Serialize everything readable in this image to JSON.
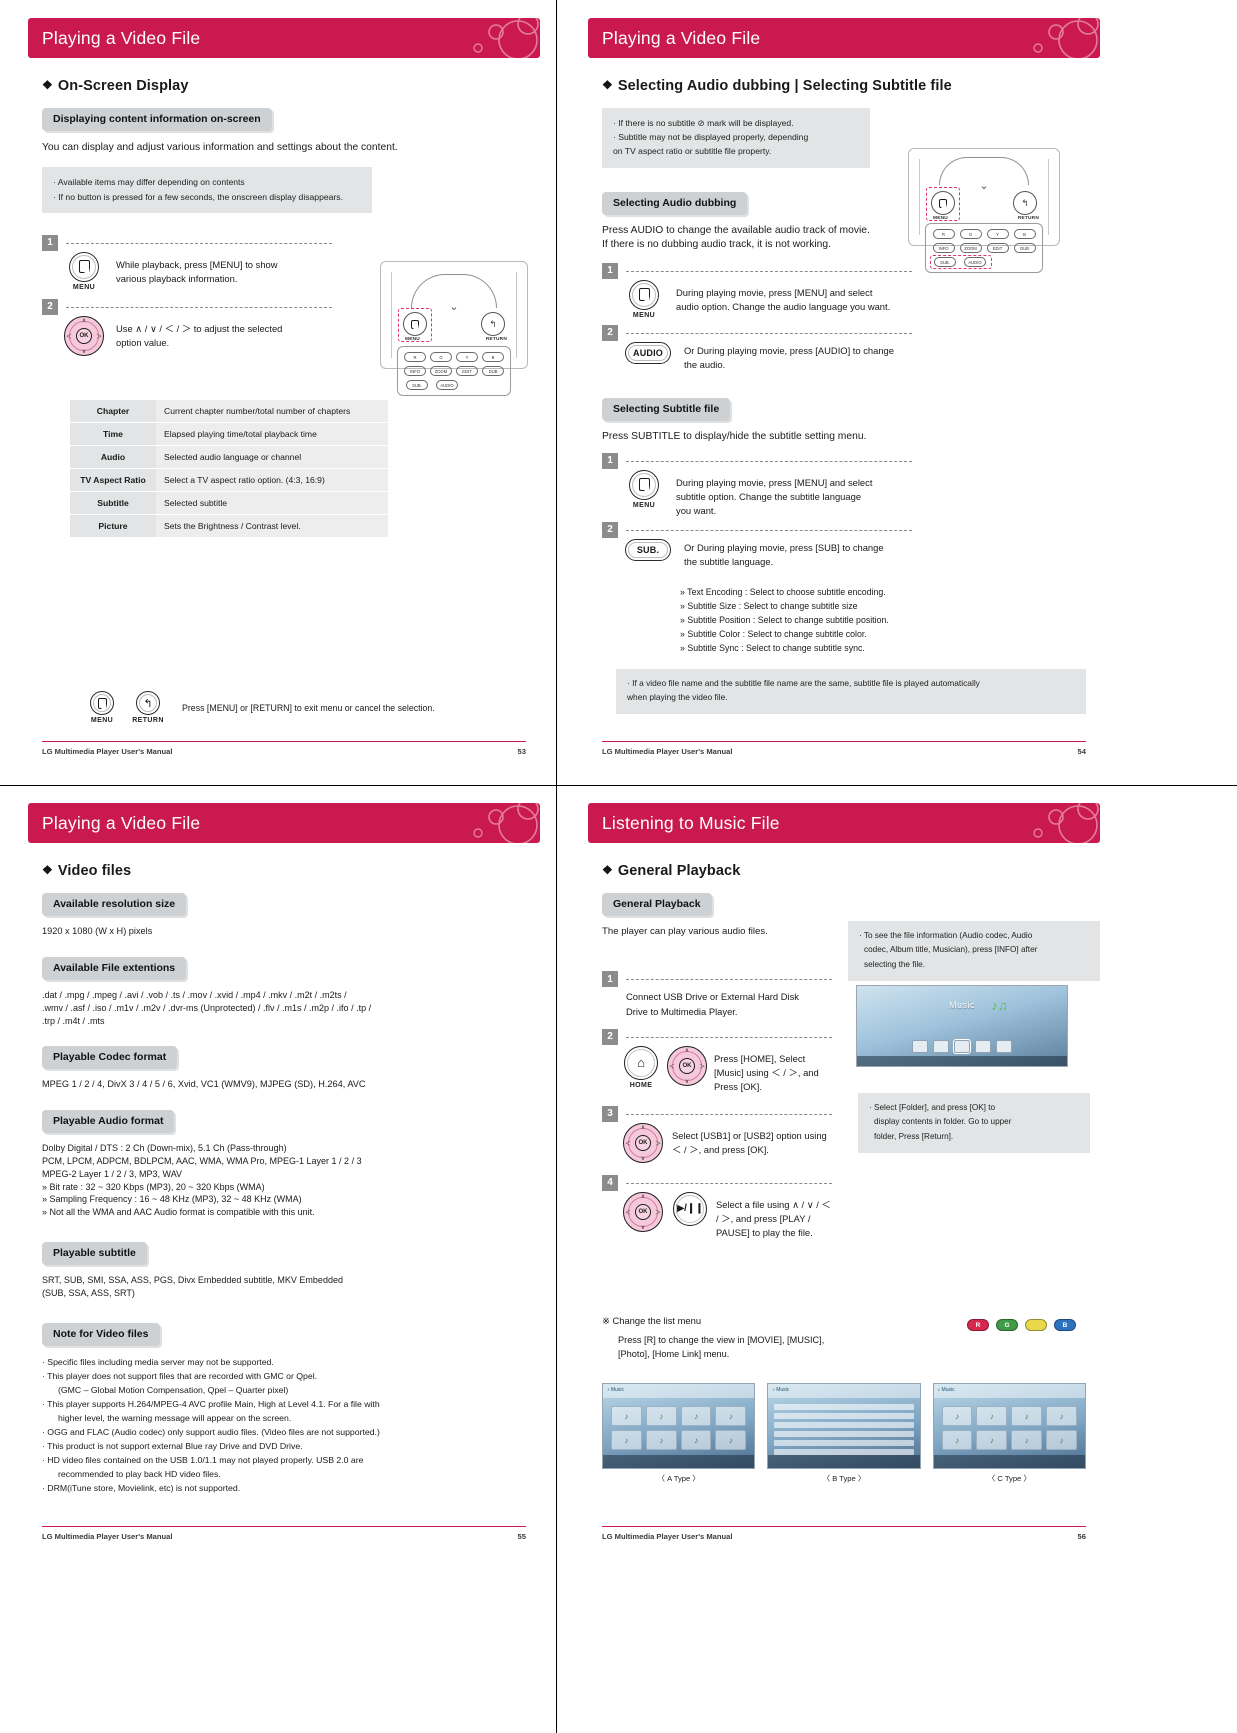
{
  "brand_color": "#c9194e",
  "pages": [
    {
      "id": "page-53",
      "banner_title": "Playing a Video File",
      "section_title": "On-Screen Display",
      "pill_1": "Displaying content information on-screen",
      "intro": "You can display and adjust various information and settings about the content.",
      "note_items": [
        "· Available items may differ depending on contents",
        "· If no button is pressed for a few seconds, the onscreen display disappears."
      ],
      "steps": [
        {
          "num": "1",
          "key_label": "MENU",
          "key_icon": "menu-key-icon",
          "text": "While playback, press [MENU]  to show various playback information."
        },
        {
          "num": "2",
          "key_label": "",
          "key_icon": "dpad-wheel-icon",
          "text": "Use ∧ / ∨ / ＜ / ＞ to adjust the selected option value."
        }
      ],
      "table": {
        "rows": [
          {
            "key": "Chapter",
            "value": "Current chapter number/total number of chapters"
          },
          {
            "key": "Time",
            "value": "Elapsed playing time/total playback time"
          },
          {
            "key": "Audio",
            "value": "Selected audio language or channel"
          },
          {
            "key": "TV Aspect Ratio",
            "value": "Select a TV aspect ratio option. (4:3, 16:9)"
          },
          {
            "key": "Subtitle",
            "value": "Selected subtitle"
          },
          {
            "key": "Picture",
            "value": "Sets the Brightness / Contrast level."
          }
        ]
      },
      "exit_hint": "Press [MENU] or [RETURN] to exit menu or cancel the selection.",
      "exit_keys": [
        "MENU",
        "RETURN"
      ],
      "footer_left": "LG Multimedia Player User's Manual",
      "footer_right": "53"
    },
    {
      "id": "page-54",
      "banner_title": "Playing a Video File",
      "section_title": "Selecting Audio dubbing | Selecting Subtitle file",
      "note_items": [
        "· If there is no subtitle ⊘ mark will be displayed.",
        "· Subtitle may not be displayed properly, depending",
        "  on TV aspect ratio or subtitle file property."
      ],
      "pill_audio": "Selecting Audio dubbing",
      "audio_intro_1": "Press AUDIO to change the available audio track of movie.",
      "audio_intro_2": "If there is no dubbing audio track, it is not working.",
      "audio_steps": [
        {
          "num": "1",
          "key_label": "MENU",
          "key_icon": "menu-key-icon",
          "text": "During playing movie, press [MENU] and select audio option. Change the audio language you want."
        },
        {
          "num": "2",
          "key_label": "AUDIO",
          "key_icon": "audio-key-icon",
          "text": "Or During playing movie, press [AUDIO] to change the audio."
        }
      ],
      "pill_subtitle": "Selecting Subtitle file",
      "subtitle_intro": "Press SUBTITLE to display/hide the subtitle setting menu.",
      "subtitle_steps": [
        {
          "num": "1",
          "key_label": "MENU",
          "key_icon": "menu-key-icon",
          "text": "During playing movie, press [MENU] and select subtitle option. Change the subtitle language you want."
        },
        {
          "num": "2",
          "key_label": "SUB.",
          "key_icon": "sub-key-icon",
          "text": "Or During playing movie, press [SUB] to change the subtitle language."
        }
      ],
      "subtitle_options": [
        "» Text Encoding : Select to choose subtitle encoding.",
        "» Subtitle Size : Select to change subtitle size",
        "» Subtitle Position : Select to change subtitle position.",
        "» Subtitle Color : Select to change subtitle color.",
        "» Subtitle Sync : Select to change subtitle sync."
      ],
      "bottom_note": [
        "· If a video file name and the subtitle file name are the same, subtitle file is played automatically",
        "  when playing the video file."
      ],
      "footer_left": "LG Multimedia Player User's Manual",
      "footer_right": "54"
    },
    {
      "id": "page-55",
      "banner_title": "Playing a Video File",
      "section_title": "Video files",
      "blocks": [
        {
          "pill": "Available resolution size",
          "lines": [
            "1920 x 1080 (W x H) pixels"
          ]
        },
        {
          "pill": "Available File extentions",
          "lines": [
            ".dat / .mpg / .mpeg / .avi / .vob / .ts / .mov / .xvid / .mp4 / .mkv / .m2t / .m2ts /",
            ".wmv / .asf / .iso / .m1v / .m2v / .dvr-ms (Unprotected) / .flv / .m1s / .m2p / .ifo / .tp /",
            ".trp / .m4t / .mts"
          ]
        },
        {
          "pill": "Playable Codec format",
          "lines": [
            "MPEG 1 / 2 / 4, DivX 3 / 4 / 5 / 6, Xvid, VC1 (WMV9), MJPEG (SD), H.264, AVC"
          ]
        },
        {
          "pill": "Playable Audio format",
          "lines": [
            "Dolby Digital / DTS : 2 Ch (Down-mix), 5.1 Ch (Pass-through)",
            "PCM, LPCM, ADPCM, BDLPCM, AAC, WMA, WMA Pro, MPEG-1 Layer 1 / 2 / 3",
            "MPEG-2 Layer 1 / 2 / 3, MP3, WAV",
            "» Bit rate : 32 ~ 320 Kbps (MP3), 20 ~ 320 Kbps (WMA)",
            "» Sampling Frequency : 16 ~ 48 KHz (MP3), 32 ~ 48 KHz (WMA)",
            "» Not all the WMA and AAC Audio format is compatible with this unit."
          ]
        },
        {
          "pill": "Playable subtitle",
          "lines": [
            "SRT, SUB, SMI, SSA, ASS, PGS, Divx Embedded subtitle, MKV Embedded",
            "(SUB, SSA, ASS, SRT)"
          ]
        }
      ],
      "note_pill": "Note for Video files",
      "note_lines": [
        {
          "t": "· Specific files including media server may not be supported.",
          "cont": false
        },
        {
          "t": "· This player does not support files that are recorded with GMC or Qpel.",
          "cont": false
        },
        {
          "t": "(GMC – Global Motion Compensation, Qpel – Quarter pixel)",
          "cont": true
        },
        {
          "t": "· This player supports H.264/MPEG-4 AVC profile Main, High at Level 4.1. For a file with",
          "cont": false
        },
        {
          "t": "higher level, the warning message will appear on the screen.",
          "cont": true
        },
        {
          "t": "· OGG and FLAC (Audio codec) only support audio files. (Video files are not supported.)",
          "cont": false
        },
        {
          "t": "· This product is not support external Blue ray Drive and DVD Drive.",
          "cont": false
        },
        {
          "t": "· HD video files contained on the USB 1.0/1.1 may not played properly. USB 2.0 are",
          "cont": false
        },
        {
          "t": "recommended to play back HD video files.",
          "cont": true
        },
        {
          "t": "· DRM(iTune store, Movielink, etc) is not supported.",
          "cont": false
        }
      ],
      "footer_left": "LG Multimedia Player User's Manual",
      "footer_right": "55"
    },
    {
      "id": "page-56",
      "banner_title": "Listening to Music File",
      "section_title": "General Playback",
      "pill_general": "General Playback",
      "intro": "The player can play various audio files.",
      "side_note": [
        "· To see the file information (Audio codec, Audio",
        "codec, Album title, Musician), press [INFO] after",
        "selecting the file."
      ],
      "steps": [
        {
          "num": "1",
          "keys": [],
          "text": "Connect USB Drive or External Hard Disk Drive to Multimedia Player."
        },
        {
          "num": "2",
          "keys": [
            "home-key-icon",
            "dpad-wheel-icon"
          ],
          "key_label": "HOME",
          "text": "Press [HOME], Select [Music] using ＜ / ＞, and Press [OK]."
        },
        {
          "num": "3",
          "keys": [
            "dpad-wheel-icon"
          ],
          "key_label": "",
          "text": "Select [USB1] or [USB2] option using ＜ / ＞, and press [OK]."
        },
        {
          "num": "4",
          "keys": [
            "dpad-wheel-icon",
            "playpause-key-icon"
          ],
          "key_label": "",
          "text": "Select a file using ∧ / ∨ / ＜ / ＞, and press [PLAY / PAUSE] to play the file."
        }
      ],
      "side_note_2": [
        "· Select [Folder], and press [OK] to",
        "display contents in folder. Go to upper",
        "folder, Press [Return]."
      ],
      "tv_screen_label": "Music",
      "change_menu_title": "※ Change the list menu",
      "change_menu_text": [
        "Press [R] to change the view in [MOVIE], [MUSIC],",
        "[Photo], [Home Link] menu."
      ],
      "color_keys": [
        {
          "label": "R",
          "color": "#d6284f"
        },
        {
          "label": "G",
          "color": "#3f9b46"
        },
        {
          "label": "",
          "color": "#e8d84a"
        },
        {
          "label": "B",
          "color": "#2d72c0"
        }
      ],
      "thumb_captions": [
        "〈 A Type 〉",
        "〈 B Type 〉",
        "〈 C Type 〉"
      ],
      "footer_left": "LG Multimedia Player User's Manual",
      "footer_right": "56"
    }
  ]
}
